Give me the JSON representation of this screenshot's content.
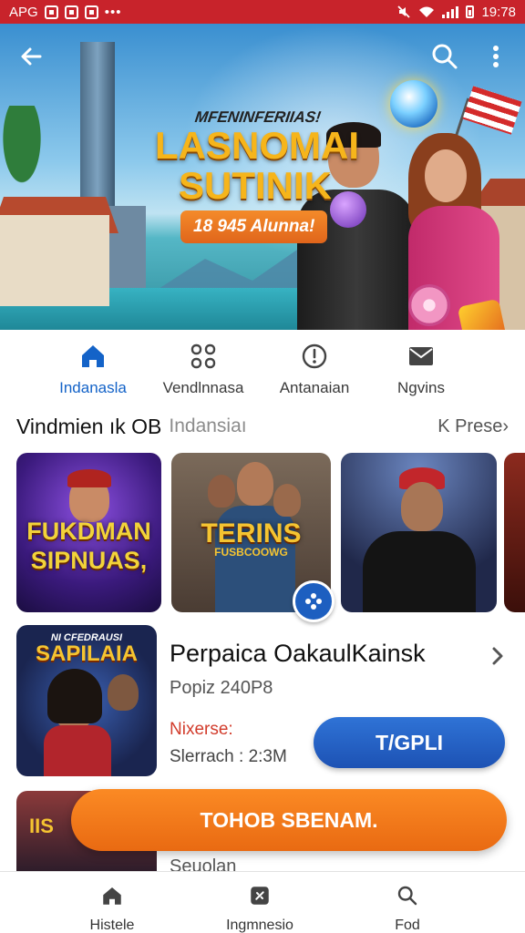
{
  "status_bar": {
    "carrier": "APG",
    "time": "19:78",
    "dots": "•••",
    "bg_color": "#c8232b"
  },
  "hero": {
    "subtitle": "MFENINFERIIAS!",
    "title": "LASNOMAI SUTINIK",
    "pill": "18 945 Alunna!",
    "icons": [
      "back-arrow-icon",
      "search-icon",
      "more-vertical-icon"
    ]
  },
  "tabs": [
    {
      "label": "Indanasla",
      "icon": "home-icon",
      "active": true
    },
    {
      "label": "Vendlnnasa",
      "icon": "grid-icon",
      "active": false
    },
    {
      "label": "Antanaian",
      "icon": "more-circle-icon",
      "active": false
    },
    {
      "label": "Ngvins",
      "icon": "mail-icon",
      "active": false
    }
  ],
  "section": {
    "title": "Vindmien ık OB",
    "subtitle": "Indansiaı",
    "more": "K Prese›"
  },
  "carousel": [
    {
      "title": "FUKDMAN SIPNUAS,"
    },
    {
      "title": "TERINS",
      "subtitle": "FUSBCOOWG"
    },
    {
      "title": ""
    },
    {
      "title": ""
    }
  ],
  "featured": {
    "thumb_subtitle": "NI CFEDRAUSI",
    "thumb_title": "SAPILAIA",
    "title": "Perpaica OakaulKainsk",
    "meta": "Popiz 240P8",
    "label": "Nixerse:",
    "size": "Slerrach : 2:3M",
    "install_label": "T/GPLI"
  },
  "second_item": {
    "thumb_title": "IIS",
    "text": "Seuolan"
  },
  "promo_button": "TOHOB SBENAM.",
  "bottom_nav": [
    {
      "label": "Histele",
      "icon": "home-icon"
    },
    {
      "label": "Ingmnesio",
      "icon": "apps-icon"
    },
    {
      "label": "Fod",
      "icon": "search-icon"
    }
  ],
  "colors": {
    "accent_blue": "#1463c8",
    "install_blue": "#1d52b4",
    "promo_orange": "#f07a1c",
    "hero_title_gold": "#f6b51b"
  }
}
